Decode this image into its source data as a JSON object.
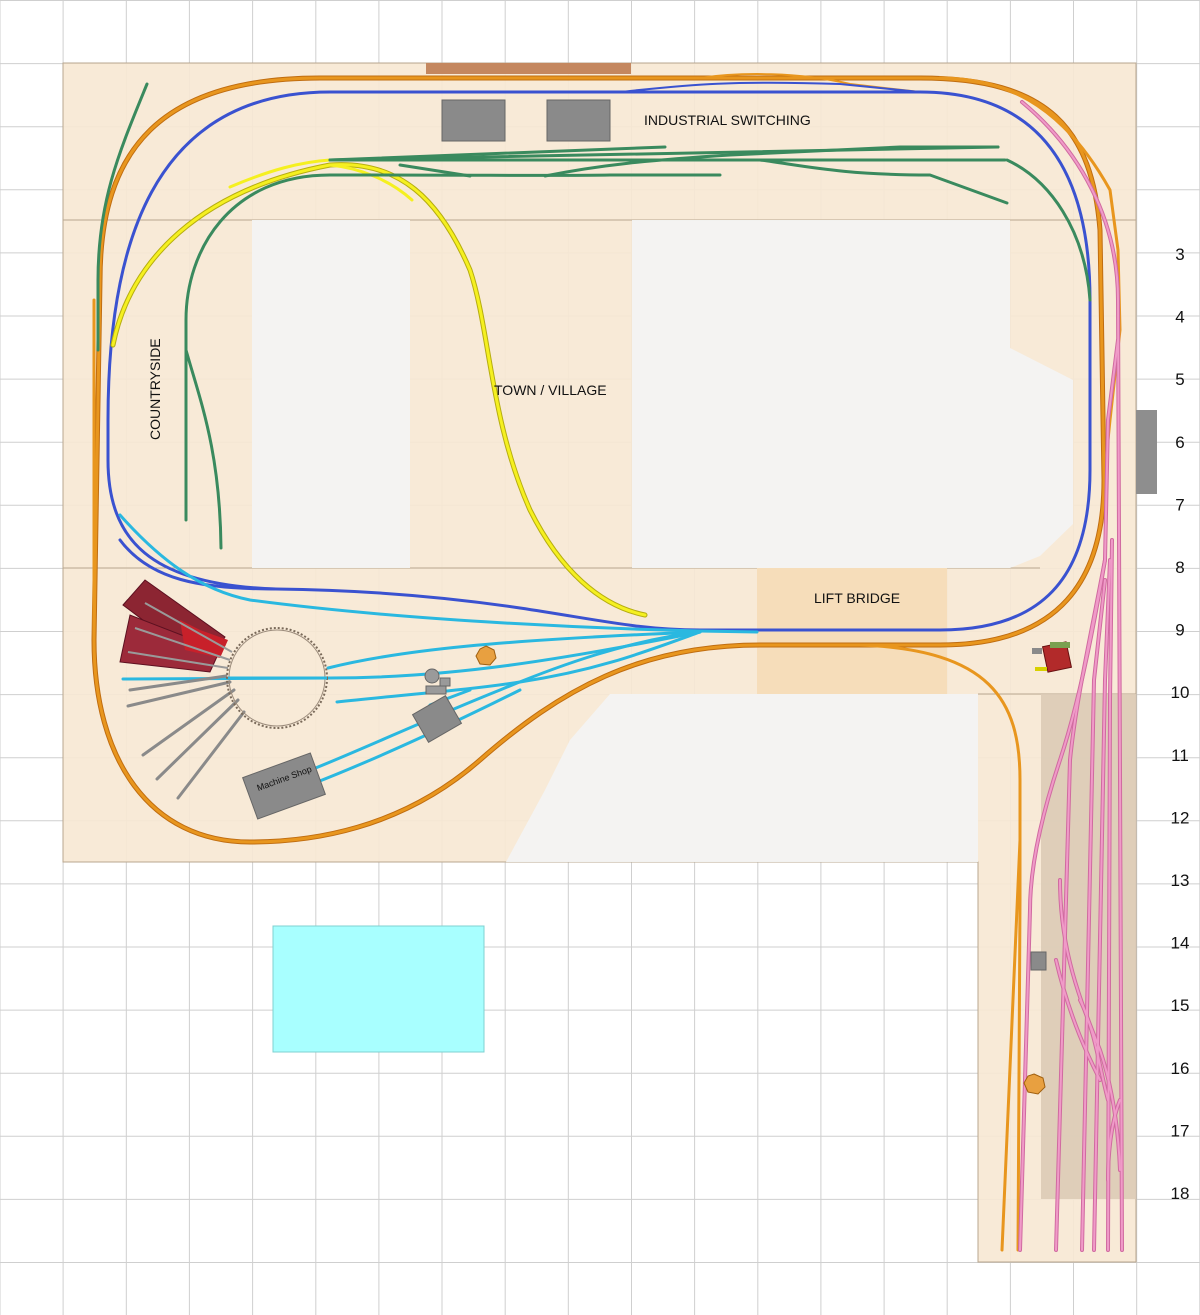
{
  "areas": {
    "industrial": "INDUSTRIAL SWITCHING",
    "countryside": "COUNTRYSIDE",
    "town": "TOWN / VILLAGE",
    "lift_bridge": "LIFT BRIDGE",
    "machine_shop": "Machine Shop"
  },
  "grid_labels": [
    "3",
    "4",
    "5",
    "6",
    "7",
    "8",
    "9",
    "10",
    "11",
    "12",
    "13",
    "14",
    "15",
    "16",
    "17",
    "18"
  ],
  "colors": {
    "grid_line": "#c8c8c8",
    "benchwork": "#f7e8d4",
    "benchwork_edge": "#b9a78f",
    "scenery_panel": "#f3f3f3",
    "lift_bridge": "#f6ddba",
    "yard_panel": "#dccbb6",
    "water": "#a8ffff",
    "mainline_orange": "#e8961e",
    "mainline_blue": "#3a52d0",
    "siding_green": "#3a8a5e",
    "yellow_loop": "#f5f020",
    "engine_cyan": "#2ab8e0",
    "yard_pink": "#f09ac8",
    "roundhouse": "#8c2532",
    "building_gray": "#8a8a8a"
  },
  "icons": [
    "turntable-icon",
    "roundhouse-icon",
    "water-tower-icon",
    "building-icon",
    "station-icon"
  ]
}
